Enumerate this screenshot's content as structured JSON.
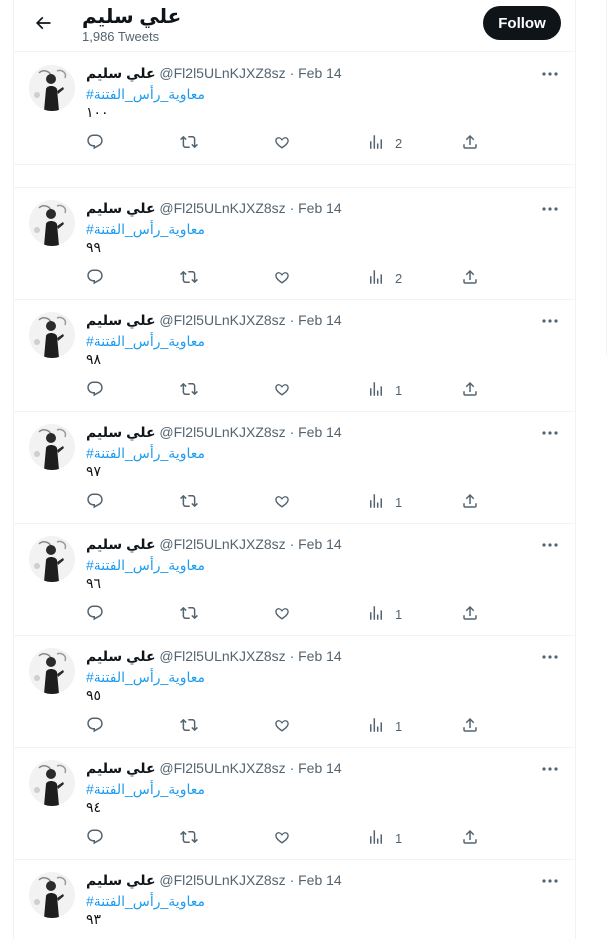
{
  "header": {
    "title": "علي سليم",
    "tweet_count": "1,986 Tweets",
    "follow_label": "Follow"
  },
  "tweets": [
    {
      "name": "علي سليم",
      "handle": "@Fl2l5ULnKJXZ8sz",
      "date": "Feb 14",
      "hashtag": "#معاوية_رأس_الفتنة",
      "text": "١٠٠",
      "views": "2"
    },
    {
      "name": "علي سليم",
      "handle": "@Fl2l5ULnKJXZ8sz",
      "date": "Feb 14",
      "hashtag": "#معاوية_رأس_الفتنة",
      "text": "٩٩",
      "views": "2"
    },
    {
      "name": "علي سليم",
      "handle": "@Fl2l5ULnKJXZ8sz",
      "date": "Feb 14",
      "hashtag": "#معاوية_رأس_الفتنة",
      "text": "٩٨",
      "views": "1"
    },
    {
      "name": "علي سليم",
      "handle": "@Fl2l5ULnKJXZ8sz",
      "date": "Feb 14",
      "hashtag": "#معاوية_رأس_الفتنة",
      "text": "٩٧",
      "views": "1"
    },
    {
      "name": "علي سليم",
      "handle": "@Fl2l5ULnKJXZ8sz",
      "date": "Feb 14",
      "hashtag": "#معاوية_رأس_الفتنة",
      "text": "٩٦",
      "views": "1"
    },
    {
      "name": "علي سليم",
      "handle": "@Fl2l5ULnKJXZ8sz",
      "date": "Feb 14",
      "hashtag": "#معاوية_رأس_الفتنة",
      "text": "٩٥",
      "views": "1"
    },
    {
      "name": "علي سليم",
      "handle": "@Fl2l5ULnKJXZ8sz",
      "date": "Feb 14",
      "hashtag": "#معاوية_رأس_الفتنة",
      "text": "٩٤",
      "views": "1"
    },
    {
      "name": "علي سليم",
      "handle": "@Fl2l5ULnKJXZ8sz",
      "date": "Feb 14",
      "hashtag": "#معاوية_رأس_الفتنة",
      "text": "٩٣",
      "views": ""
    }
  ],
  "icons": {
    "back": "arrow-left-icon",
    "more": "more-icon",
    "reply": "reply-icon",
    "retweet": "retweet-icon",
    "like": "heart-icon",
    "views": "views-icon",
    "share": "share-icon"
  },
  "colors": {
    "hashtag": "#1d9bf0",
    "secondary_text": "#536471",
    "follow_bg": "#0f1419"
  }
}
